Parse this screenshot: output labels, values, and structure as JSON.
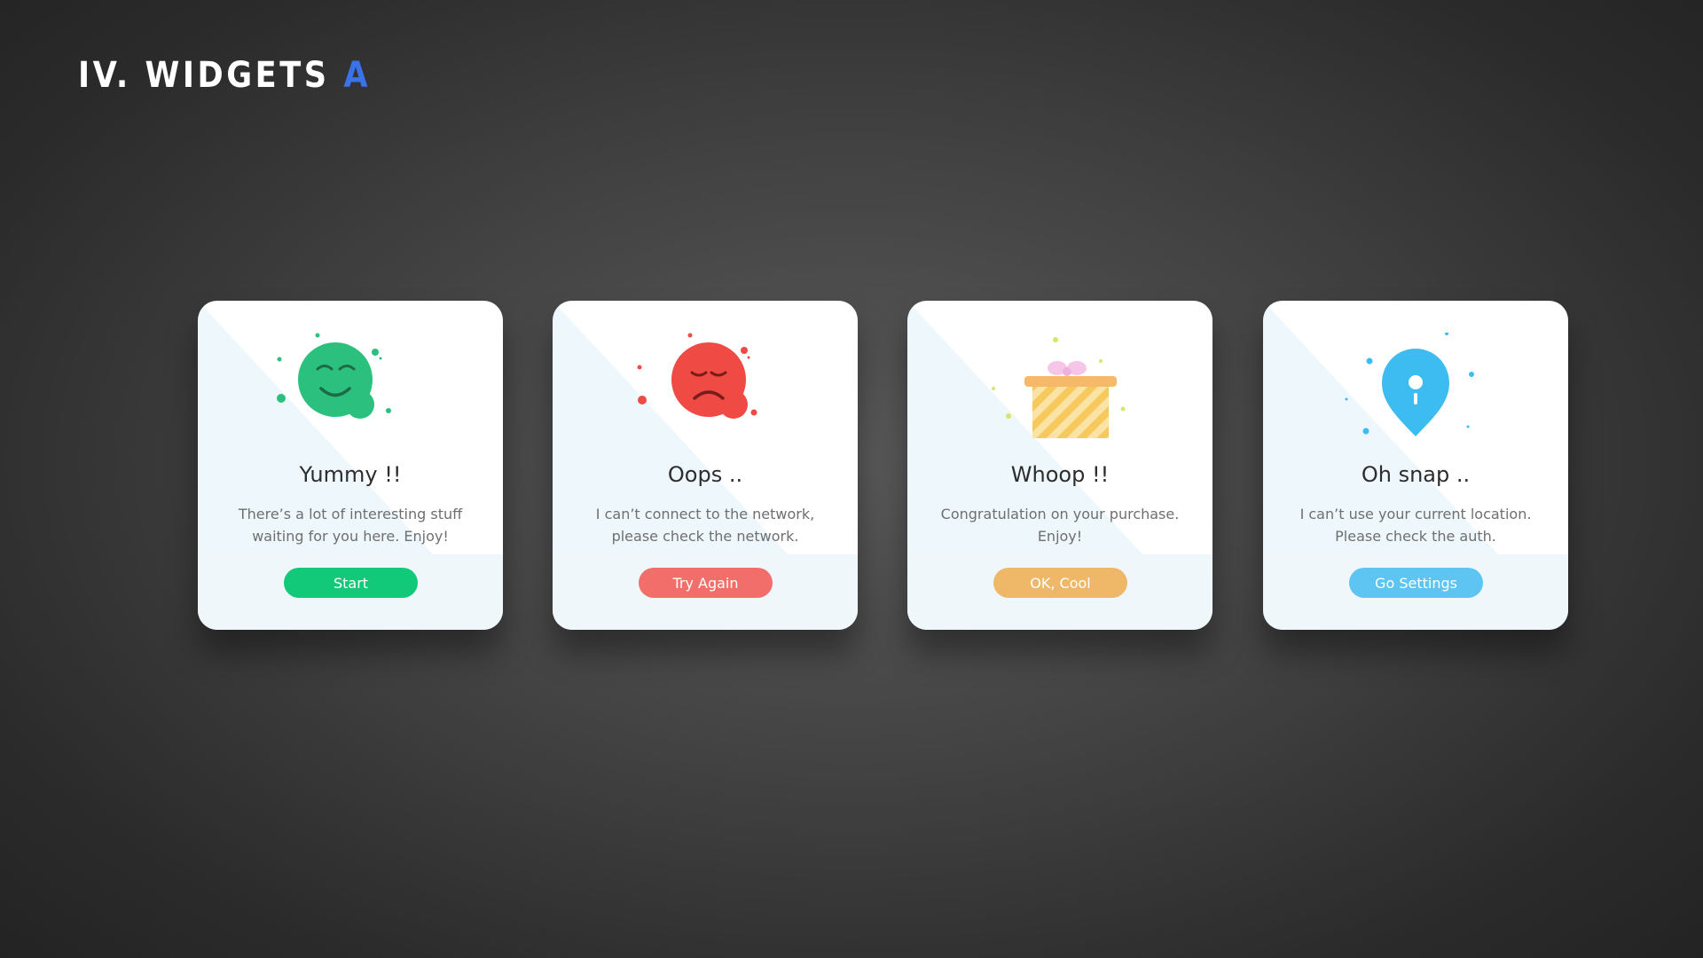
{
  "page": {
    "title": "IV. WIDGETS",
    "title_accent": "A",
    "accent_color": "#3a72e8"
  },
  "cards": [
    {
      "icon": "happy-face-icon",
      "title": "Yummy !!",
      "message_line1": "There’s a lot of interesting stuff",
      "message_line2": "waiting for you here. Enjoy!",
      "button_label": "Start",
      "button_color": "#12c97a",
      "icon_color": "#2cc07e"
    },
    {
      "icon": "sad-face-icon",
      "title": "Oops ..",
      "message_line1": "I can’t connect to the network,",
      "message_line2": "please check the network.",
      "button_label": "Try Again",
      "button_color": "#f26e6a",
      "icon_color": "#f04a45"
    },
    {
      "icon": "gift-box-icon",
      "title": "Whoop !!",
      "message_line1": "Congratulation on your purchase.",
      "message_line2": "Enjoy!",
      "button_label": "OK, Cool",
      "button_color": "#efb868",
      "icon_color": "#f7c85c"
    },
    {
      "icon": "location-pin-icon",
      "title": "Oh snap ..",
      "message_line1": "I can’t use your current location.",
      "message_line2": "Please check the auth.",
      "button_label": "Go Settings",
      "button_color": "#5ec5f2",
      "icon_color": "#3cbcf0"
    }
  ]
}
